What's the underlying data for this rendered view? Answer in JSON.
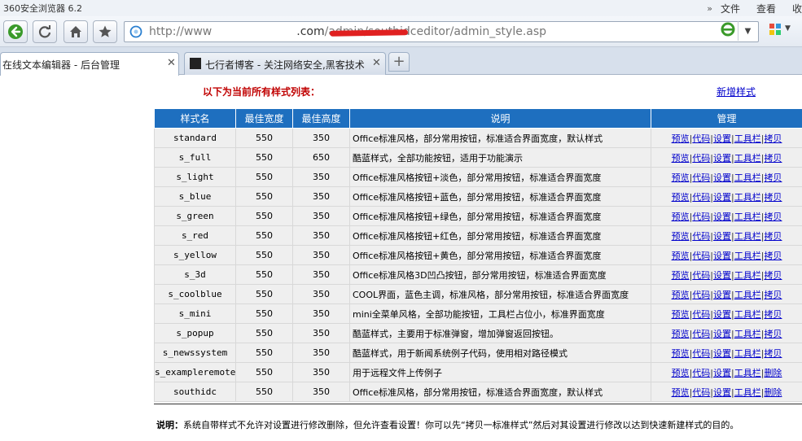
{
  "browser": {
    "app_title": "360安全浏览器 6.2",
    "menu": [
      "文件",
      "查看",
      "收"
    ],
    "address": {
      "prefix": "http://www",
      "domain": ".com",
      "path": "/admin/southidceditor/admin_style.asp"
    },
    "tabs": [
      {
        "label": "在线文本编辑器 - 后台管理",
        "active": true
      },
      {
        "label": "七行者博客 - 关注网络安全,黑客技术",
        "active": false
      }
    ],
    "new_tab_label": "+"
  },
  "page": {
    "heading": "以下为当前所有样式列表：",
    "add_link": "新增样式",
    "table": {
      "headers": [
        "样式名",
        "最佳宽度",
        "最佳高度",
        "说明",
        "管理"
      ],
      "rows": [
        {
          "name": "standard",
          "width": "550",
          "height": "350",
          "desc": "Office标准风格，部分常用按钮，标准适合界面宽度，默认样式",
          "actions": [
            "预览",
            "代码",
            "设置",
            "工具栏",
            "拷贝"
          ]
        },
        {
          "name": "s_full",
          "width": "550",
          "height": "650",
          "desc": "酷蓝样式，全部功能按钮，适用于功能演示",
          "actions": [
            "预览",
            "代码",
            "设置",
            "工具栏",
            "拷贝"
          ]
        },
        {
          "name": "s_light",
          "width": "550",
          "height": "350",
          "desc": "Office标准风格按钮+淡色，部分常用按钮，标准适合界面宽度",
          "actions": [
            "预览",
            "代码",
            "设置",
            "工具栏",
            "拷贝"
          ]
        },
        {
          "name": "s_blue",
          "width": "550",
          "height": "350",
          "desc": "Office标准风格按钮+蓝色，部分常用按钮，标准适合界面宽度",
          "actions": [
            "预览",
            "代码",
            "设置",
            "工具栏",
            "拷贝"
          ]
        },
        {
          "name": "s_green",
          "width": "550",
          "height": "350",
          "desc": "Office标准风格按钮+绿色，部分常用按钮，标准适合界面宽度",
          "actions": [
            "预览",
            "代码",
            "设置",
            "工具栏",
            "拷贝"
          ]
        },
        {
          "name": "s_red",
          "width": "550",
          "height": "350",
          "desc": "Office标准风格按钮+红色，部分常用按钮，标准适合界面宽度",
          "actions": [
            "预览",
            "代码",
            "设置",
            "工具栏",
            "拷贝"
          ]
        },
        {
          "name": "s_yellow",
          "width": "550",
          "height": "350",
          "desc": "Office标准风格按钮+黄色，部分常用按钮，标准适合界面宽度",
          "actions": [
            "预览",
            "代码",
            "设置",
            "工具栏",
            "拷贝"
          ]
        },
        {
          "name": "s_3d",
          "width": "550",
          "height": "350",
          "desc": "Office标准风格3D凹凸按钮，部分常用按钮，标准适合界面宽度",
          "actions": [
            "预览",
            "代码",
            "设置",
            "工具栏",
            "拷贝"
          ]
        },
        {
          "name": "s_coolblue",
          "width": "550",
          "height": "350",
          "desc": "COOL界面，蓝色主调，标准风格，部分常用按钮，标准适合界面宽度",
          "actions": [
            "预览",
            "代码",
            "设置",
            "工具栏",
            "拷贝"
          ]
        },
        {
          "name": "s_mini",
          "width": "550",
          "height": "350",
          "desc": "mini全菜单风格，全部功能按钮，工具栏占位小，标准界面宽度",
          "actions": [
            "预览",
            "代码",
            "设置",
            "工具栏",
            "拷贝"
          ]
        },
        {
          "name": "s_popup",
          "width": "550",
          "height": "350",
          "desc": "酷蓝样式，主要用于标准弹窗，增加弹窗返回按钮。",
          "actions": [
            "预览",
            "代码",
            "设置",
            "工具栏",
            "拷贝"
          ]
        },
        {
          "name": "s_newssystem",
          "width": "550",
          "height": "350",
          "desc": "酷蓝样式，用于新闻系统例子代码，使用相对路径模式",
          "actions": [
            "预览",
            "代码",
            "设置",
            "工具栏",
            "拷贝"
          ]
        },
        {
          "name": "s_exampleremote",
          "width": "550",
          "height": "350",
          "desc": "用于远程文件上传例子",
          "actions": [
            "预览",
            "代码",
            "设置",
            "工具栏",
            "删除"
          ]
        },
        {
          "name": "southidc",
          "width": "550",
          "height": "350",
          "desc": "Office标准风格，部分常用按钮，标准适合界面宽度，默认样式",
          "actions": [
            "预览",
            "代码",
            "设置",
            "工具栏",
            "删除"
          ]
        }
      ]
    },
    "note_label": "说明：",
    "note_text": "系统自带样式不允许对设置进行修改删除，但允许查看设置！你可以先“拷贝一标准样式”然后对其设置进行修改以达到快速新建样式的目的。"
  },
  "colors": {
    "header_bg": "#1e6fbf",
    "heading_red": "#c00000",
    "link_blue": "#0000cc",
    "row_bg": "#efefef"
  }
}
